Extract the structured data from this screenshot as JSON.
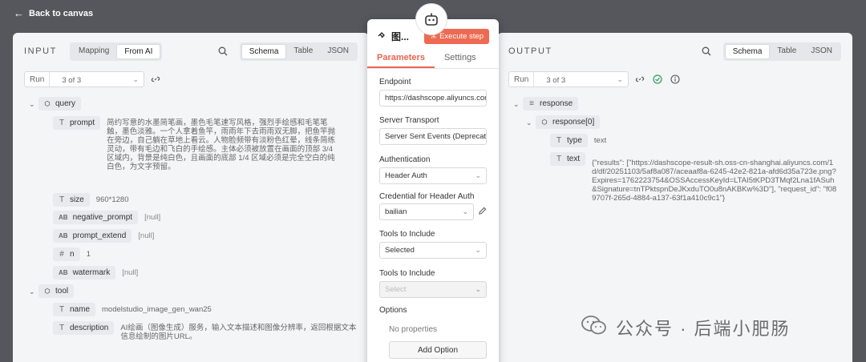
{
  "topbar": {
    "back_label": "Back to canvas"
  },
  "input": {
    "title": "INPUT",
    "modes": [
      "Mapping",
      "From AI"
    ],
    "views": [
      "Schema",
      "Table",
      "JSON"
    ],
    "run_label": "Run",
    "run_value": "3 of 3",
    "tree": {
      "query_label": "query",
      "prompt_label": "prompt",
      "prompt_value": "简约写意的水墨简笔画，墨色毛笔速写风格，强烈手绘感和毛笔笔触，墨色淡雅。一个人拿着鱼竿，雨雨年下去雨雨双无脚，把鱼竿抛在旁边，自己躺在草地上看云。人物脸频带有淡粉色红晕，线条简练灵动，带有毛边和飞白的手绘感。主体必须被放置在画面的顶部 3/4 区域内，背景是纯白色，且画面的底部 1/4 区域必须是完全空白的纯白色，为文字预留。",
      "size_label": "size",
      "size_value": "960*1280",
      "negative_prompt_label": "negative_prompt",
      "negative_prompt_value": "[null]",
      "prompt_extend_label": "prompt_extend",
      "prompt_extend_value": "[null]",
      "n_label": "n",
      "n_value": "1",
      "watermark_label": "watermark",
      "watermark_value": "[null]",
      "tool_label": "tool",
      "name_label": "name",
      "name_value": "modelstudio_image_gen_wan25",
      "description_label": "description",
      "description_value": "AI绘画（图像生成）服务，输入文本描述和图像分辨率，返回根据文本信息绘制的图片URL。"
    }
  },
  "modal": {
    "title": "图...",
    "execute_label": "Execute step",
    "tabs": [
      "Parameters",
      "Settings"
    ],
    "endpoint_label": "Endpoint",
    "endpoint_value": "https://dashscope.aliyuncs.com",
    "transport_label": "Server Transport",
    "transport_value": "Server Sent Events (Deprecated)",
    "auth_label": "Authentication",
    "auth_value": "Header Auth",
    "cred_label": "Credential for Header Auth",
    "cred_value": "bailian",
    "tools_label": "Tools to Include",
    "tools_value": "Selected",
    "tools2_label": "Tools to Include",
    "tools2_placeholder": "Select",
    "options_label": "Options",
    "no_props": "No properties",
    "add_option": "Add Option"
  },
  "output": {
    "title": "OUTPUT",
    "views": [
      "Schema",
      "Table",
      "JSON"
    ],
    "run_label": "Run",
    "run_value": "3 of 3",
    "tree": {
      "response_label": "response",
      "response0_label": "response[0]",
      "type_label": "type",
      "type_value": "text",
      "text_label": "text",
      "text_value": "{\"results\": [\"https://dashscope-result-sh.oss-cn-shanghai.aliyuncs.com/1d/df/20251103/5af8a087/aceaaf8a-6245-42e2-821a-afd6d35a723e.png?Expires=1762223754&OSSAccessKeyId=LTAI5tKPD3TMqf2Lna1fASuh&Signature=tnTPktspnDeJKxduTO0u8nAKBKw%3D\"], \"request_id\": \"f089707f-265d-4884-a137-63f1a410c9c1\"}"
    }
  },
  "watermark": {
    "text": "公众号 · 后端小肥肠"
  }
}
